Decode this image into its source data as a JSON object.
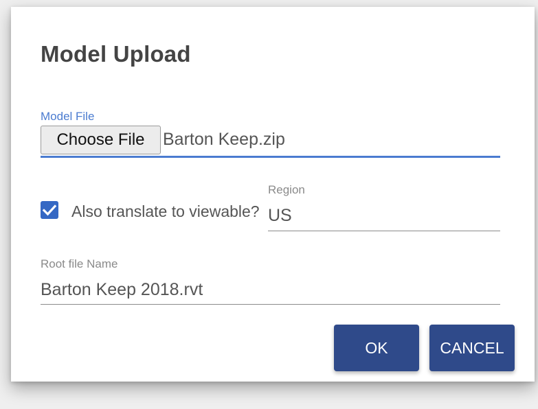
{
  "dialog": {
    "title": "Model Upload"
  },
  "model_file": {
    "label": "Model File",
    "choose_button": "Choose File",
    "file_name": "Barton Keep.zip"
  },
  "translate": {
    "checked": true,
    "label": "Also translate to viewable?"
  },
  "region": {
    "label": "Region",
    "value": "US"
  },
  "root_file": {
    "label": "Root file Name",
    "value": "Barton Keep 2018.rvt"
  },
  "buttons": {
    "ok": "OK",
    "cancel": "CANCEL"
  },
  "colors": {
    "accent": "#4a7bd0",
    "checkbox": "#3568c4",
    "button_bg": "#2f4a8a"
  }
}
